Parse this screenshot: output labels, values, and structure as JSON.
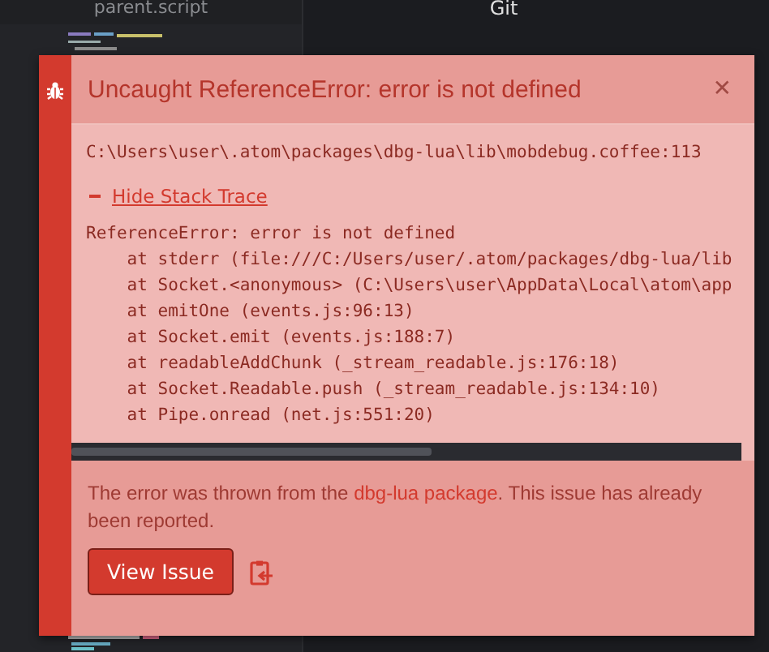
{
  "editor_tab": {
    "title": "parent.script"
  },
  "git_panel": {
    "title": "Git"
  },
  "notification": {
    "title": "Uncaught ReferenceError: error is not defined",
    "close": "✕",
    "location": "C:\\Users\\user\\.atom\\packages\\dbg-lua\\lib\\mobdebug.coffee:113",
    "toggle": {
      "label": "Hide Stack Trace",
      "expanded": true
    },
    "stack": [
      "ReferenceError: error is not defined",
      "    at stderr (file:///C:/Users/user/.atom/packages/dbg-lua/lib",
      "    at Socket.<anonymous> (C:\\Users\\user\\AppData\\Local\\atom\\app",
      "    at emitOne (events.js:96:13)",
      "    at Socket.emit (events.js:188:7)",
      "    at readableAddChunk (_stream_readable.js:176:18)",
      "    at Socket.Readable.push (_stream_readable.js:134:10)",
      "    at Pipe.onread (net.js:551:20)"
    ],
    "message": [
      "The error was thrown from the ",
      "dbg-lua package",
      ". This issue has already been reported."
    ],
    "button": "View Issue"
  }
}
